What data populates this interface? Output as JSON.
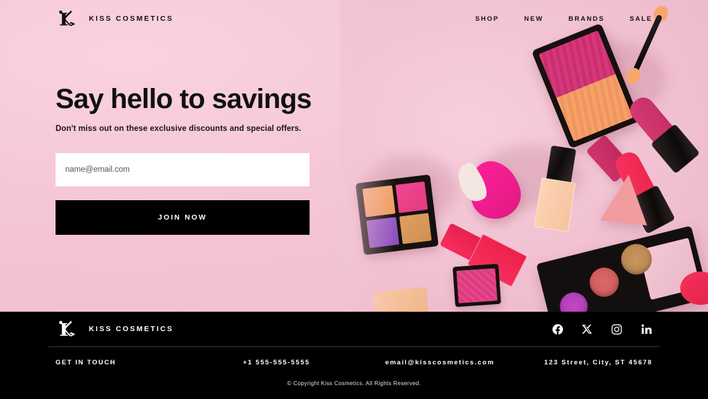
{
  "brand": {
    "name": "KISS COSMETICS",
    "logo_icon": "k-monogram-icon"
  },
  "nav": {
    "items": [
      {
        "label": "SHOP"
      },
      {
        "label": "NEW"
      },
      {
        "label": "BRANDS"
      },
      {
        "label": "SALE"
      }
    ]
  },
  "hero": {
    "headline": "Say hello to savings",
    "subheadline": "Don't miss out on these exclusive discounts and special offers.",
    "email_placeholder": "name@email.com",
    "email_value": "",
    "cta_label": "JOIN NOW",
    "background_color": "#f4c6d5",
    "image_alt": "Flat lay of pink cosmetics: eyeshadow palettes, blush, nail polish, lipsticks, beauty sponges"
  },
  "footer": {
    "brand_name": "KISS COSMETICS",
    "contact_label": "GET IN TOUCH",
    "phone": "+1 555-555-5555",
    "email": "email@kisscosmetics.com",
    "address": "123 Street, City, ST 45678",
    "copyright": "© Copyright Kiss Cosmetics. All Rights Reserved.",
    "socials": [
      {
        "name": "facebook-icon"
      },
      {
        "name": "x-twitter-icon"
      },
      {
        "name": "instagram-icon"
      },
      {
        "name": "linkedin-icon"
      }
    ]
  },
  "colors": {
    "background_pink": "#f4c6d5",
    "footer_black": "#000000",
    "text_black": "#111111",
    "input_white": "#ffffff"
  }
}
